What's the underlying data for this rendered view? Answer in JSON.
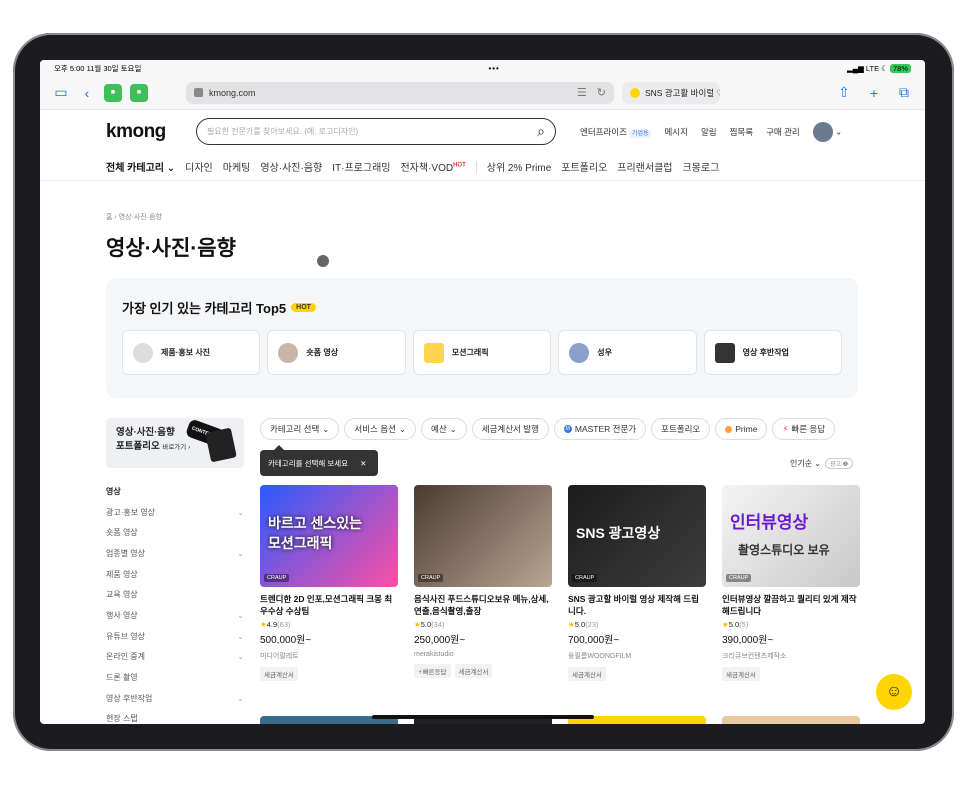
{
  "status": {
    "time_date": "오후 5:00  11월 30일 토요일",
    "dots": "•••",
    "signal": "LTE",
    "battery": "78%"
  },
  "browser": {
    "url": "kmong.com",
    "tab_title": "SNS 광고활 바이럴 ♡"
  },
  "header": {
    "logo": "kmong",
    "search_placeholder": "필요한 전문가를 찾아보세요. (예: 로고디자인)",
    "nav": {
      "enterprise": "엔터프라이즈",
      "enterprise_badge": "기업용",
      "messages": "메시지",
      "alerts": "알림",
      "wishlist": "찜목록",
      "purchases": "구매 관리"
    }
  },
  "catnav": {
    "all": "전체 카테고리",
    "items": [
      "디자인",
      "마케팅",
      "영상·사진·음향",
      "IT·프로그래밍",
      "전자책·VOD"
    ],
    "hot": "HOT",
    "extra": [
      "상위 2% Prime",
      "포트폴리오",
      "프리랜서클럽",
      "크몽로그"
    ]
  },
  "breadcrumb": "홈 › 영상·사진·음향",
  "page_title": "영상·사진·음향",
  "top5": {
    "title": "가장 인기 있는 카테고리 Top5",
    "badge": "HOT",
    "items": [
      "제품·홍보 사진",
      "숏폼 영상",
      "모션그래픽",
      "성우",
      "영상 후반작업"
    ]
  },
  "promo": {
    "line1": "영상·사진·음향",
    "line2": "포트폴리오",
    "more": "바로가기 ›",
    "sticker": "CONTENTS"
  },
  "sidebar": {
    "heading": "영상",
    "items": [
      {
        "label": "광고·홍보 영상",
        "chev": "⌄"
      },
      {
        "label": "숏폼 영상",
        "chev": ""
      },
      {
        "label": "업종별 영상",
        "chev": "⌄"
      },
      {
        "label": "제품 영상",
        "chev": ""
      },
      {
        "label": "교육 영상",
        "chev": ""
      },
      {
        "label": "행사 영상",
        "chev": "⌄"
      },
      {
        "label": "유튜브 영상",
        "chev": "⌄"
      },
      {
        "label": "온라인 중계",
        "chev": "⌄"
      },
      {
        "label": "드론 촬영",
        "chev": ""
      },
      {
        "label": "영상 후반작업",
        "chev": "⌄"
      },
      {
        "label": "현장 스탭",
        "chev": ""
      }
    ]
  },
  "filters": [
    "카테고리 선택",
    "서비스 옵션",
    "예산",
    "세금계산서 발행",
    "MASTER 전문가",
    "포트폴리오",
    "Prime",
    "빠른 응답"
  ],
  "tooltip": {
    "text": "카테고리를 선택해 보세요",
    "close": "✕"
  },
  "sort": {
    "label": "인기순 ⌄",
    "ad": "광고 ❶"
  },
  "cards": [
    {
      "thumb_text": "바르고 센스있는\n모션그래픽",
      "tag": "CRAUP",
      "title": "트렌디한 2D 인포,모션그래픽 크몽 최우수상 수상팀",
      "rating": "4.9",
      "count": "(63)",
      "price": "500,000원~",
      "seller": "미디어팔레트",
      "tags": [
        "세금계산서"
      ]
    },
    {
      "thumb_text": "",
      "tag": "CRAUP",
      "title": "음식사진 푸드스튜디오보유 메뉴,상세,연출,음식촬영,출장",
      "rating": "5.0",
      "count": "(34)",
      "price": "250,000원~",
      "seller": "merakistudio",
      "tags": [
        "빠른응답",
        "세금계산서"
      ]
    },
    {
      "thumb_text": "SNS 광고영상",
      "tag": "CRAUP",
      "title": "SNS 광고할 바이럴 영상 제작해 드립니다.",
      "rating": "5.0",
      "count": "(23)",
      "price": "700,000원~",
      "seller": "웅필름WOONGFILM",
      "tags": [
        "세금계산서"
      ]
    },
    {
      "thumb_text": "인터뷰영상",
      "thumb_sub": "촬영스튜디오 보유",
      "tag": "CRAUP",
      "title": "인터뷰영상 깔끔하고 퀄리티 있게 제작해드립니다",
      "rating": "5.0",
      "count": "(5)",
      "price": "390,000원~",
      "seller": "크리큐브컨텐츠제작소",
      "tags": [
        "세금계산서"
      ]
    }
  ]
}
